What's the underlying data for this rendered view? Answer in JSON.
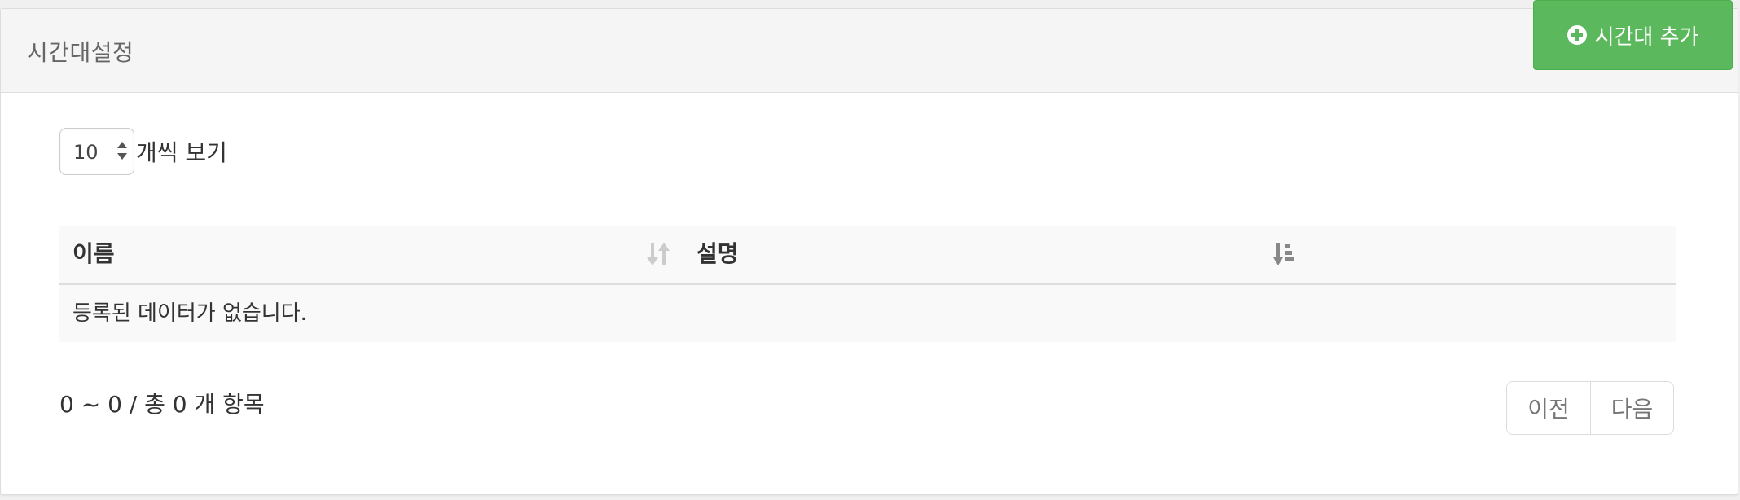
{
  "panel": {
    "title": "시간대설정",
    "add_button_label": "시간대 추가",
    "add_button_icon": "plus-circle-icon",
    "accent_color": "#5cb85c"
  },
  "length_menu": {
    "selected": "10",
    "label": "개씩 보기"
  },
  "table": {
    "columns": [
      {
        "label": "이름",
        "sort_icon": "sort-both-icon"
      },
      {
        "label": "설명",
        "sort_icon": "sort-amount-asc-icon"
      }
    ],
    "empty_message": "등록된 데이터가 없습니다."
  },
  "info": "0 ~ 0 / 총 0 개 항목",
  "pagination": {
    "prev_label": "이전",
    "next_label": "다음"
  }
}
